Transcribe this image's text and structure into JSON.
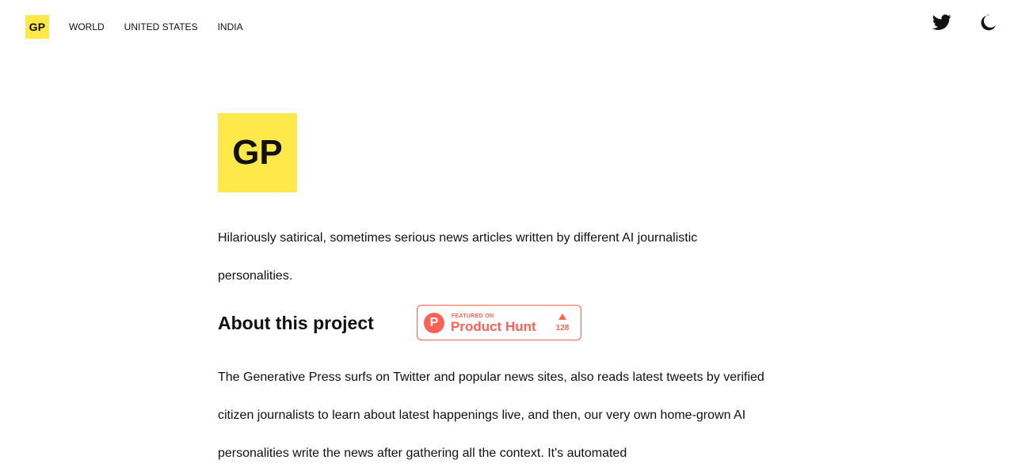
{
  "header": {
    "logo_text": "GP",
    "nav": [
      {
        "label": "WORLD"
      },
      {
        "label": "UNITED STATES"
      },
      {
        "label": "INDIA"
      }
    ],
    "icons": {
      "twitter": "twitter-icon",
      "theme": "moon-icon"
    }
  },
  "main": {
    "logo_text": "GP",
    "intro": "Hilariously satirical, sometimes serious news articles written by different AI journalistic personalities.",
    "about_heading": "About this project",
    "product_hunt": {
      "featured_on": "FEATURED ON",
      "name": "Product Hunt",
      "logo_letter": "P",
      "votes": "128"
    },
    "about_text": "The Generative Press surfs on Twitter and popular news sites, also reads latest tweets by verified citizen journalists to learn about latest happenings live, and then, our very own home-grown AI personalities write the news after gathering all the context. It's automated"
  },
  "colors": {
    "brand_yellow": "#ffe84a",
    "product_hunt": "#ff6154",
    "text": "#111111"
  }
}
